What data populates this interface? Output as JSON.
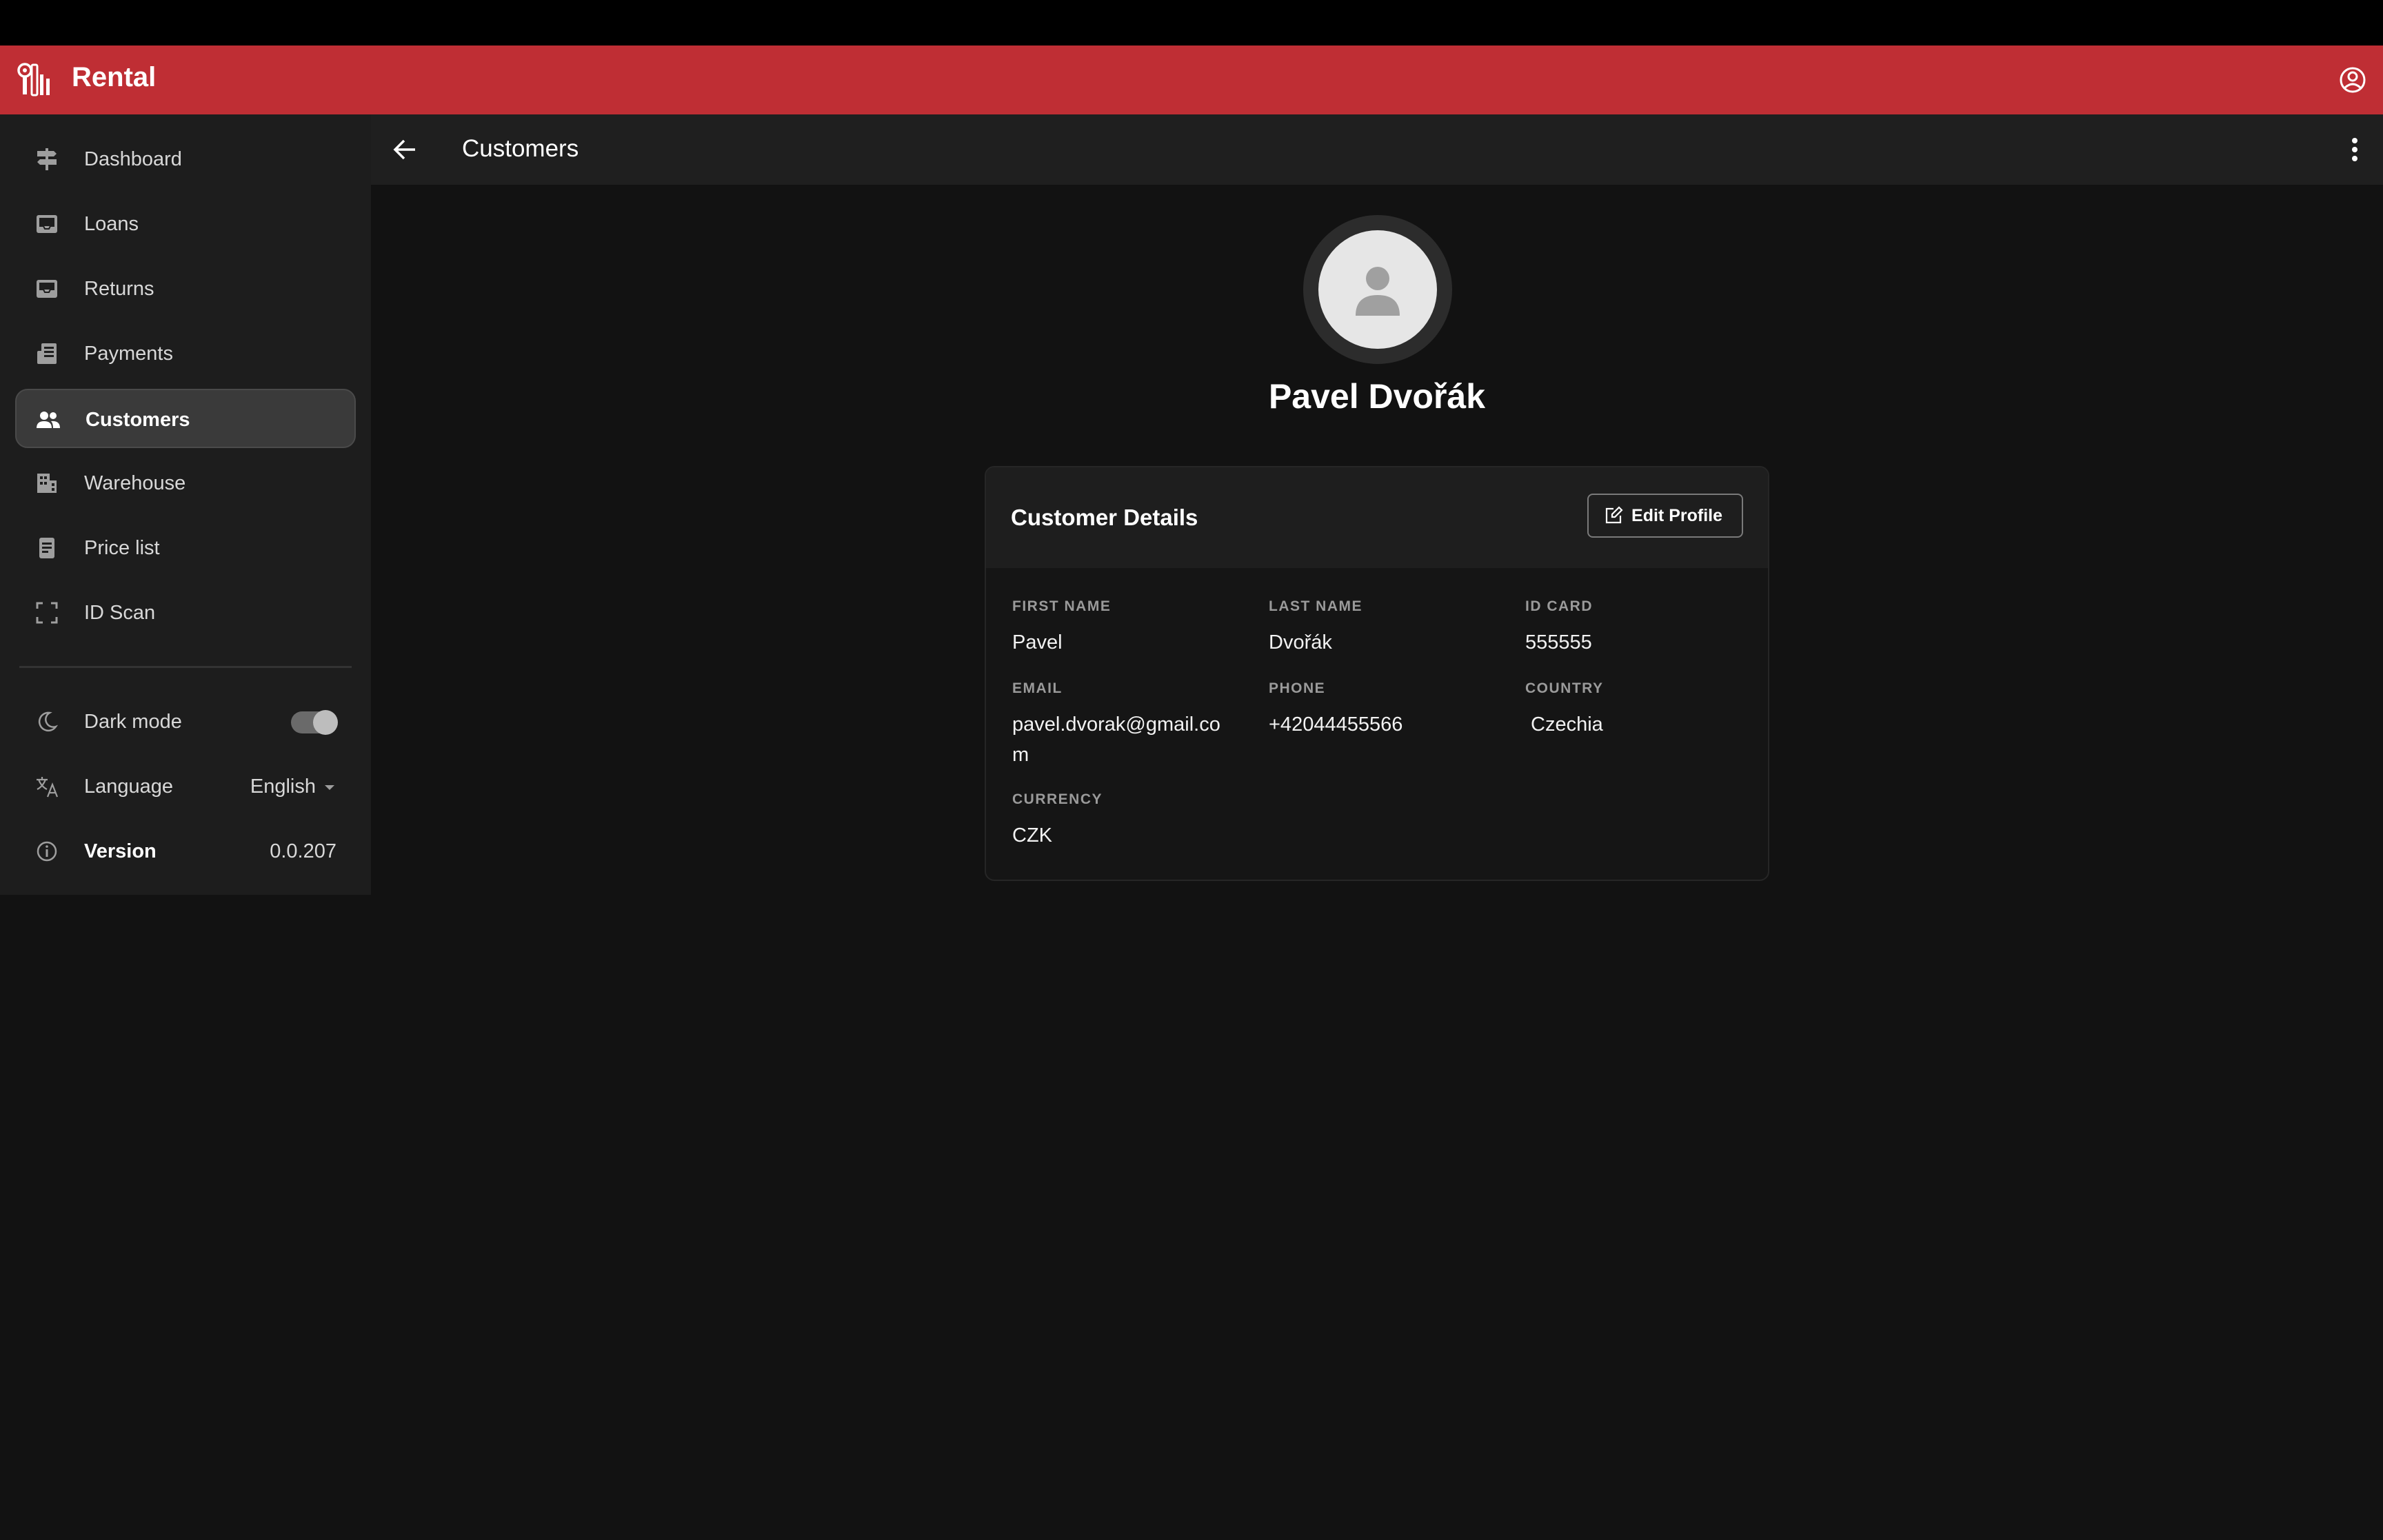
{
  "app": {
    "title": "Rental",
    "brand_color": "#bf2e34"
  },
  "toolbar": {
    "title": "Customers"
  },
  "sidebar": {
    "items": [
      {
        "label": "Dashboard",
        "icon": "signpost-icon"
      },
      {
        "label": "Loans",
        "icon": "tray-out-icon"
      },
      {
        "label": "Returns",
        "icon": "tray-in-icon"
      },
      {
        "label": "Payments",
        "icon": "receipt-icon"
      },
      {
        "label": "Customers",
        "icon": "people-icon",
        "active": true
      },
      {
        "label": "Warehouse",
        "icon": "building-icon"
      },
      {
        "label": "Price list",
        "icon": "document-icon"
      },
      {
        "label": "ID Scan",
        "icon": "scan-frame-icon"
      }
    ],
    "dark_mode": {
      "label": "Dark mode",
      "enabled": true
    },
    "language": {
      "label": "Language",
      "value": "English"
    },
    "version": {
      "label": "Version",
      "value": "0.0.207"
    }
  },
  "customer": {
    "name": "Pavel Dvořák",
    "card_title": "Customer Details",
    "edit_label": "Edit Profile",
    "fields": {
      "first_name": {
        "label": "FIRST NAME",
        "value": "Pavel"
      },
      "last_name": {
        "label": "LAST NAME",
        "value": "Dvořák"
      },
      "id_card": {
        "label": "ID CARD",
        "value": "555555"
      },
      "email": {
        "label": "EMAIL",
        "value": "pavel.dvorak@gmail.com"
      },
      "phone": {
        "label": "PHONE",
        "value": "+42044455566"
      },
      "country": {
        "label": "COUNTRY",
        "value": "Czechia"
      },
      "currency": {
        "label": "CURRENCY",
        "value": "CZK"
      }
    }
  }
}
